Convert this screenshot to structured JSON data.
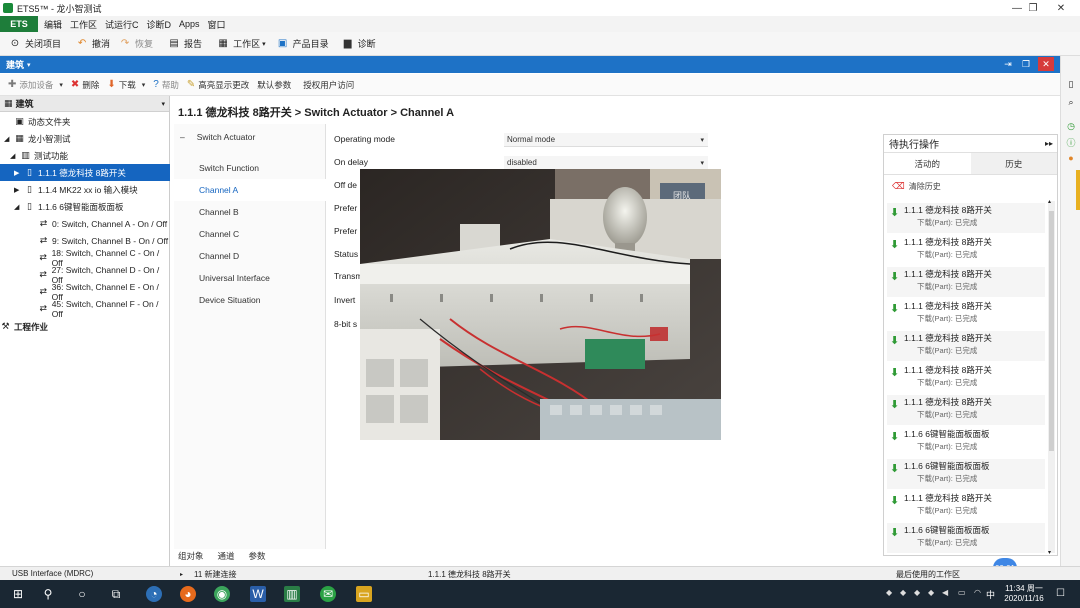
{
  "window": {
    "title": "ETS5™ - 龙小智测试",
    "controls": [
      "—",
      "❐",
      "✕"
    ]
  },
  "menubar": {
    "ets_label": "ETS",
    "items": [
      "编辑",
      "工作区",
      "试运行C",
      "诊断D",
      "Apps",
      "窗口"
    ]
  },
  "toolbar": {
    "items": [
      {
        "label": "关闭项目",
        "icon": "close-project-icon"
      },
      {
        "label": "撤消",
        "icon": "undo-icon"
      },
      {
        "label": "恢复",
        "icon": "redo-icon"
      },
      {
        "label": "报告",
        "icon": "report-icon"
      },
      {
        "label": "工作区",
        "icon": "workspace-icon"
      },
      {
        "label": "产品目录",
        "icon": "catalog-icon"
      },
      {
        "label": "诊断",
        "icon": "diagnostics-icon"
      }
    ]
  },
  "panel": {
    "title": "建筑"
  },
  "toolbar2": {
    "items": [
      {
        "label": "添加设备"
      },
      {
        "label": "删除"
      },
      {
        "label": "下载"
      },
      {
        "label": "帮助"
      },
      {
        "label": "高亮显示更改"
      },
      {
        "label": "默认参数"
      },
      {
        "label": "授权用户访问"
      }
    ]
  },
  "tree": {
    "header": "建筑",
    "rows": [
      {
        "label": "动态文件夹",
        "indent": 0,
        "arrow": "",
        "selected": false
      },
      {
        "label": "龙小智测试",
        "indent": 0,
        "arrow": "◢",
        "selected": false
      },
      {
        "label": "测试功能",
        "indent": 1,
        "arrow": "◢",
        "selected": false
      },
      {
        "label": "1.1.1 德龙科技  8路开关",
        "indent": 2,
        "arrow": "▶",
        "selected": true
      },
      {
        "label": "1.1.4 MK22 xx io 输入模块",
        "indent": 2,
        "arrow": "▶",
        "selected": false
      },
      {
        "label": "1.1.6 6键智能面板面板",
        "indent": 2,
        "arrow": "◢",
        "selected": false
      },
      {
        "label": "0: Switch, Channel A - On / Off",
        "indent": 3,
        "arrow": "",
        "selected": false
      },
      {
        "label": "9: Switch, Channel B - On / Off",
        "indent": 3,
        "arrow": "",
        "selected": false
      },
      {
        "label": "18: Switch, Channel C - On / Off",
        "indent": 3,
        "arrow": "",
        "selected": false
      },
      {
        "label": "27: Switch, Channel D - On / Off",
        "indent": 3,
        "arrow": "",
        "selected": false
      },
      {
        "label": "36: Switch, Channel E - On / Off",
        "indent": 3,
        "arrow": "",
        "selected": false
      },
      {
        "label": "45: Switch, Channel F - On / Off",
        "indent": 3,
        "arrow": "",
        "selected": false
      }
    ],
    "footer": "工程作业"
  },
  "breadcrumb": "1.1.1 德龙科技  8路开关 > Switch Actuator > Channel A",
  "param_tabs": {
    "top": "Switch Actuator",
    "items": [
      "Switch Function",
      "Channel A",
      "Channel B",
      "Channel C",
      "Channel D",
      "Universal Interface",
      "Device Situation"
    ],
    "selected": "Channel A"
  },
  "params": {
    "rows": [
      {
        "label": "Operating mode",
        "value": "Normal mode"
      },
      {
        "label": "On delay",
        "value": "disabled"
      },
      {
        "label": "Off de",
        "value": ""
      },
      {
        "label": "Prefer",
        "value": ""
      },
      {
        "label": "Prefer",
        "value": ""
      },
      {
        "label": "Status",
        "value": ""
      },
      {
        "label": "Transm",
        "value": ""
      },
      {
        "label": "Invert",
        "value": ""
      },
      {
        "label": "8-bit s",
        "value": ""
      }
    ]
  },
  "photo": {
    "sign_text": "团队"
  },
  "pending": {
    "title": "待执行操作",
    "tabs": [
      "活动的",
      "历史"
    ],
    "active_tab": "历史",
    "clear_label": "清除历史",
    "items": [
      {
        "title": "1.1.1 德龙科技  8路开关",
        "status": "下载(Part): 已完成"
      },
      {
        "title": "1.1.1 德龙科技  8路开关",
        "status": "下载(Part): 已完成"
      },
      {
        "title": "1.1.1 德龙科技  8路开关",
        "status": "下载(Part): 已完成"
      },
      {
        "title": "1.1.1 德龙科技  8路开关",
        "status": "下载(Part): 已完成"
      },
      {
        "title": "1.1.1 德龙科技  8路开关",
        "status": "下载(Part): 已完成"
      },
      {
        "title": "1.1.1 德龙科技  8路开关",
        "status": "下载(Part): 已完成"
      },
      {
        "title": "1.1.1 德龙科技  8路开关",
        "status": "下载(Part): 已完成"
      },
      {
        "title": "1.1.6 6键智能面板面板",
        "status": "下载(Part): 已完成"
      },
      {
        "title": "1.1.6 6键智能面板面板",
        "status": "下载(Part): 已完成"
      },
      {
        "title": "1.1.1 德龙科技  8路开关",
        "status": "下载(Part): 已完成"
      },
      {
        "title": "1.1.6 6键智能面板面板",
        "status": "下载(Part): 已完成"
      }
    ]
  },
  "bottom_tabs": [
    "组对象",
    "通道",
    "参数"
  ],
  "statusbar": {
    "interface": "USB Interface (MDRC)",
    "info": "11 新建连接",
    "device": "1.1.1 德龙科技  8路开关",
    "workspace": "最后使用的工作区"
  },
  "badge": "00:01",
  "taskbar": {
    "time": "11:34 周一",
    "date": "2020/11/16",
    "ime": "中"
  },
  "colors": {
    "blue_bar": "#1e72c6",
    "selection": "#1565c0",
    "ets_green": "#1e7d3a",
    "success_green": "#2f9a35",
    "taskbar": "#1a2733"
  }
}
